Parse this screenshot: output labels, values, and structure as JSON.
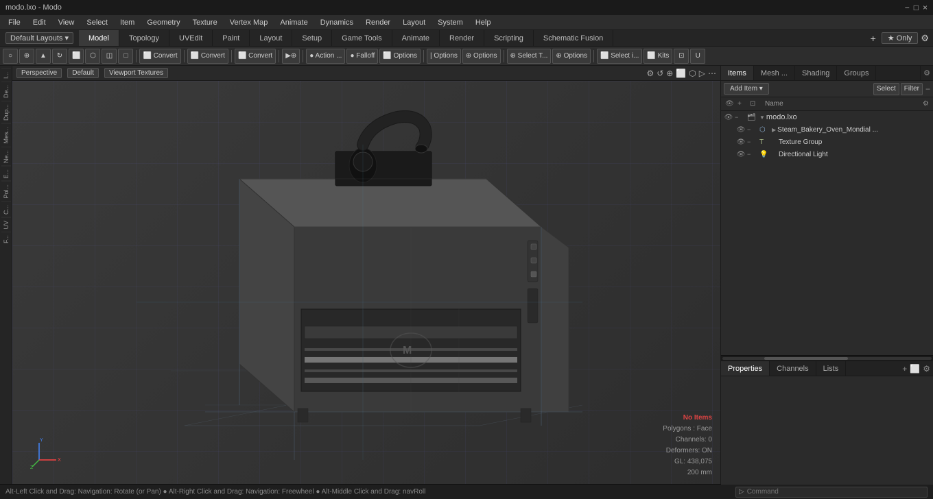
{
  "titlebar": {
    "title": "modo.lxo - Modo",
    "controls": [
      "−",
      "□",
      "×"
    ]
  },
  "menubar": {
    "items": [
      "File",
      "Edit",
      "View",
      "Select",
      "Item",
      "Geometry",
      "Texture",
      "Vertex Map",
      "Animate",
      "Dynamics",
      "Render",
      "Layout",
      "System",
      "Help"
    ]
  },
  "modebar": {
    "layout_label": "Default Layouts ▾",
    "tabs": [
      {
        "label": "Model",
        "active": true
      },
      {
        "label": "Topology",
        "active": false
      },
      {
        "label": "UVEdit",
        "active": false
      },
      {
        "label": "Paint",
        "active": false
      },
      {
        "label": "Layout",
        "active": false
      },
      {
        "label": "Setup",
        "active": false
      },
      {
        "label": "Game Tools",
        "active": false
      },
      {
        "label": "Animate",
        "active": false
      },
      {
        "label": "Render",
        "active": false
      },
      {
        "label": "Scripting",
        "active": false
      },
      {
        "label": "Schematic Fusion",
        "active": false
      }
    ],
    "plus_label": "+",
    "star_label": "★  Only",
    "gear_label": "⚙"
  },
  "toolbar": {
    "groups": [
      {
        "buttons": [
          {
            "icon": "○",
            "label": ""
          },
          {
            "icon": "⊕",
            "label": ""
          },
          {
            "icon": "△",
            "label": ""
          },
          {
            "icon": "⟲",
            "label": ""
          },
          {
            "icon": "⊡",
            "label": ""
          },
          {
            "icon": "⬡",
            "label": ""
          },
          {
            "icon": "◫",
            "label": ""
          },
          {
            "icon": "⬜",
            "label": ""
          }
        ]
      },
      {
        "buttons": [
          {
            "icon": "⬜",
            "label": "Convert"
          }
        ]
      },
      {
        "buttons": [
          {
            "icon": "⬜",
            "label": "Convert"
          }
        ]
      },
      {
        "buttons": [
          {
            "icon": "⬜",
            "label": "Convert"
          }
        ]
      },
      {
        "buttons": [
          {
            "icon": "▷",
            "label": ""
          },
          {
            "icon": "⊕",
            "label": ""
          }
        ]
      },
      {
        "buttons": [
          {
            "icon": "●",
            "label": "Action ..."
          },
          {
            "icon": "●",
            "label": "Falloff"
          },
          {
            "icon": "⬜",
            "label": "Options"
          }
        ]
      },
      {
        "buttons": [
          {
            "icon": "|",
            "label": "Options"
          },
          {
            "icon": "⊕",
            "label": "Options"
          }
        ]
      },
      {
        "buttons": [
          {
            "icon": "⊕",
            "label": "Select T..."
          },
          {
            "icon": "⊕",
            "label": "Options"
          }
        ]
      },
      {
        "buttons": [
          {
            "icon": "⬜",
            "label": "Select i..."
          },
          {
            "icon": "⬜",
            "label": "Kits"
          },
          {
            "icon": "⊡",
            "label": ""
          },
          {
            "icon": "U",
            "label": ""
          }
        ]
      }
    ]
  },
  "viewport": {
    "perspective_label": "Perspective",
    "default_label": "Default",
    "texture_label": "Viewport Textures",
    "stats": {
      "no_items": "No Items",
      "polygons": "Polygons : Face",
      "channels": "Channels: 0",
      "deformers": "Deformers: ON",
      "gl": "GL: 438,075",
      "size": "200 mm"
    },
    "axes": {
      "x": "X",
      "y": "Y",
      "z": "Z"
    }
  },
  "left_sidebar": {
    "tabs": [
      "I...",
      "De...",
      "Dup...",
      "Me...",
      "Ne...",
      "E...",
      "Pol...",
      "C...",
      "UV",
      "F..."
    ]
  },
  "item_list": {
    "tabs": [
      "Items",
      "Mesh ...",
      "Shading",
      "Groups"
    ],
    "add_item_label": "Add Item",
    "select_label": "Select",
    "filter_label": "Filter",
    "header_col": "Name",
    "items": [
      {
        "id": "root",
        "name": "modo.lxo",
        "level": 0,
        "has_arrow": true,
        "arrow_down": true,
        "icon": "🗃",
        "visible": true,
        "children": [
          {
            "id": "oven",
            "name": "Steam_Bakery_Oven_Mondial ...",
            "level": 1,
            "has_arrow": true,
            "arrow_down": false,
            "icon": "⬡",
            "visible": true
          },
          {
            "id": "texgrp",
            "name": "Texture Group",
            "level": 1,
            "has_arrow": false,
            "icon": "T",
            "visible": true
          },
          {
            "id": "light",
            "name": "Directional Light",
            "level": 1,
            "has_arrow": false,
            "icon": "💡",
            "visible": true
          }
        ]
      }
    ]
  },
  "properties": {
    "tabs": [
      "Properties",
      "Channels",
      "Lists"
    ],
    "plus_label": "+"
  },
  "statusbar": {
    "text": "Alt-Left Click and Drag: Navigation: Rotate (or Pan)  ●  Alt-Right Click and Drag: Navigation: Freewheel  ●  Alt-Middle Click and Drag: navRoll",
    "command_placeholder": "Command"
  }
}
